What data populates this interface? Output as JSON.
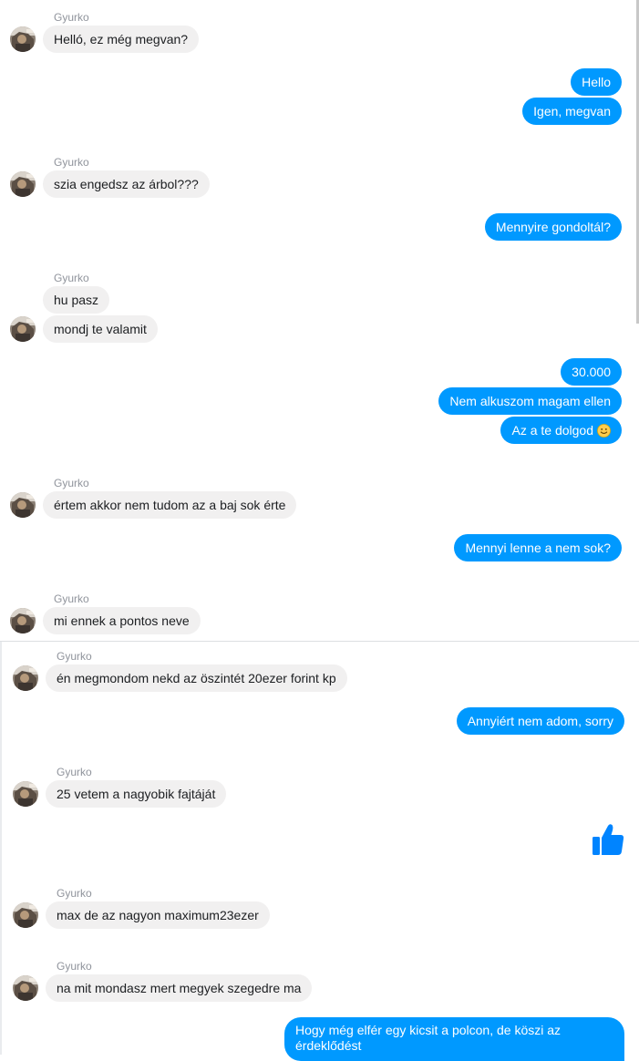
{
  "contact_name": "Gyurko",
  "colors": {
    "outgoing": "#0099ff",
    "incoming": "#f1f0f0",
    "like": "#0084ff"
  },
  "messages": {
    "m1": "Helló, ez még megvan?",
    "m2": "Hello",
    "m3": "Igen, megvan",
    "m4": "szia engedsz az árbol???",
    "m5": "Mennyire gondoltál?",
    "m6": "hu pasz",
    "m7": "mondj te valamit",
    "m8": "30.000",
    "m9": "Nem alkuszom magam ellen",
    "m10": "Az a te dolgod",
    "m11": "értem akkor nem tudom az a baj sok érte",
    "m12": "Mennyi lenne a nem sok?",
    "m13": "mi ennek a pontos neve",
    "m14": "én megmondom nekd az öszintét 20ezer forint kp",
    "m15": "Annyiért nem adom, sorry",
    "m16": "25 vetem a nagyobik fajtáját",
    "m18": "max de az nagyon maximum23ezer",
    "m19": "na mit mondasz mert megyek szegedre ma",
    "m20": "Hogy még elfér egy kicsit a polcon, de köszi az érdeklődést"
  },
  "icons": {
    "emoji": "smiley-face-icon",
    "like": "thumbs-up-icon",
    "avatar": "contact-avatar"
  }
}
